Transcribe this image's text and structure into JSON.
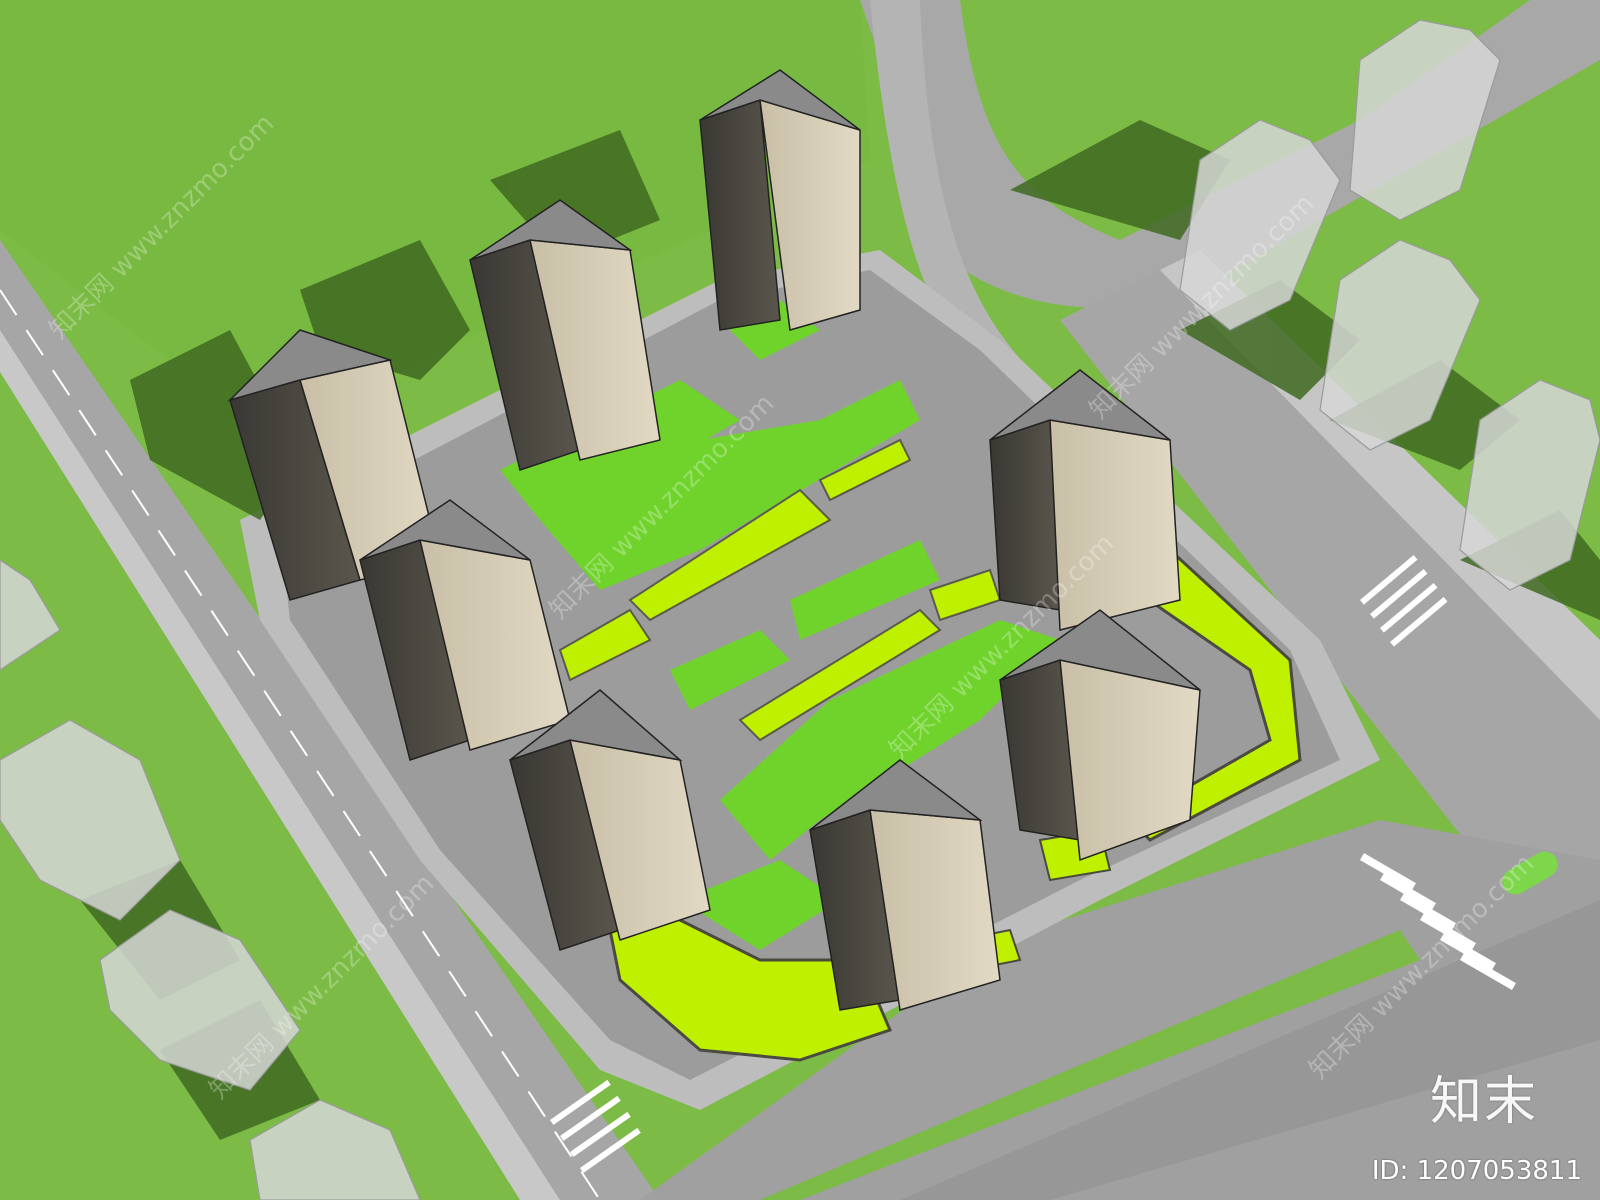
{
  "watermark": {
    "brand": "知末",
    "id_label": "ID: 1207053811",
    "diagonal_text": "知末网 www.znzmo.com"
  },
  "colors": {
    "grass": "#7cbb45",
    "road": "#a3a3a3",
    "sidewalk": "#c9c9c9",
    "podium_lime": "#bff000",
    "courtyard_green": "#6fd32c",
    "tower_body": "#d8ceb8",
    "tower_roof": "#8a8a8a",
    "context_building": "#d6d6d6",
    "shadow": "#3f6a21"
  }
}
